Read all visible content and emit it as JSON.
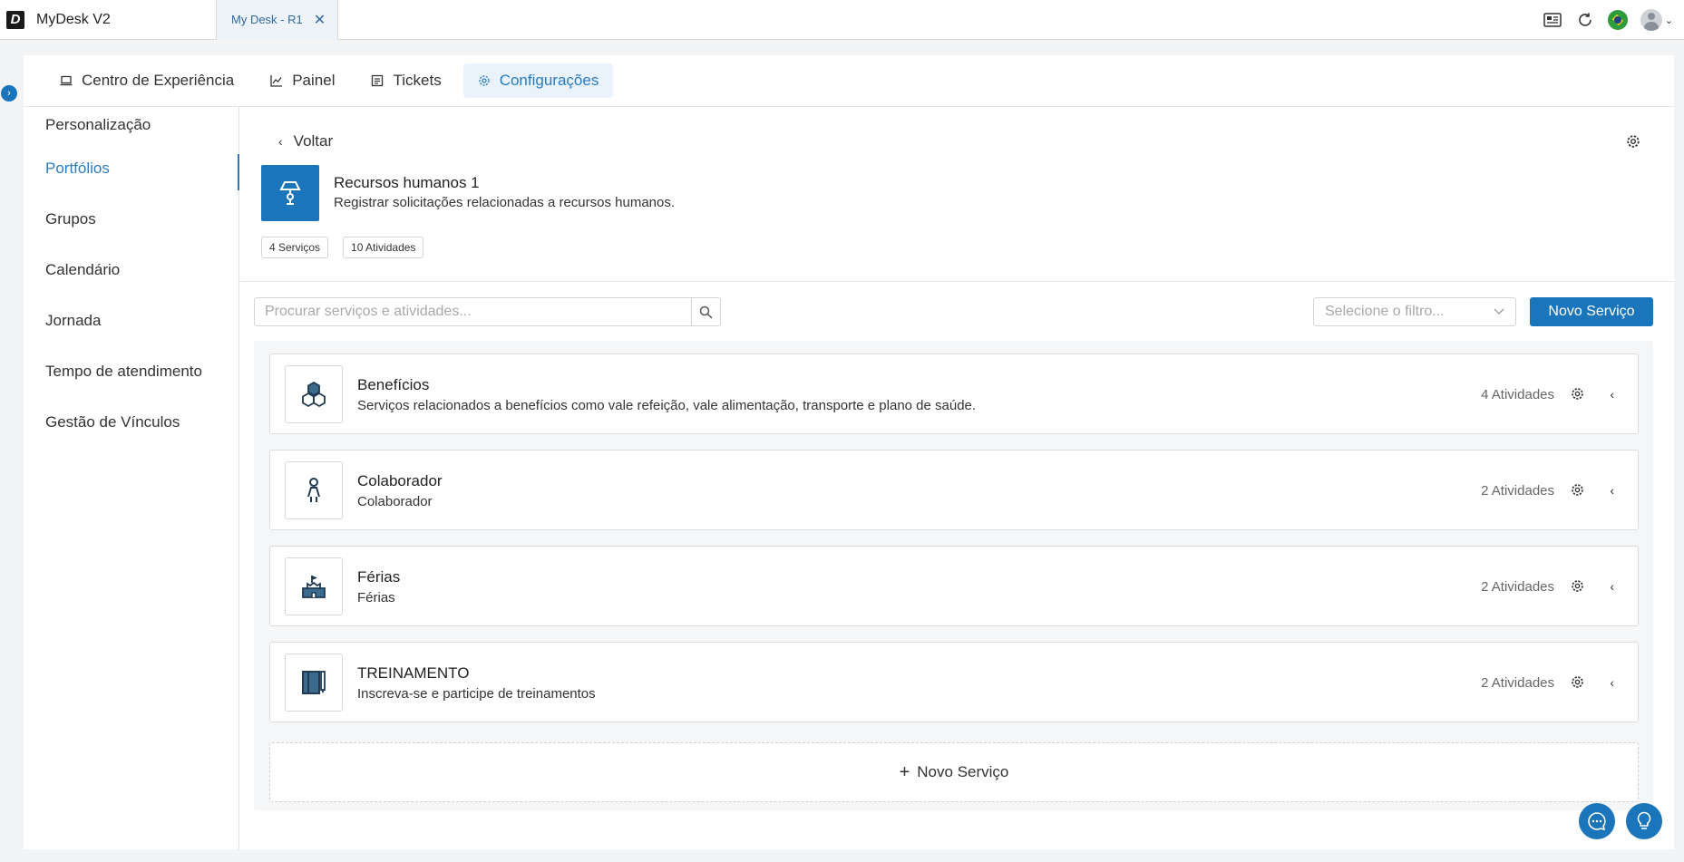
{
  "titlebar": {
    "logo_letter": "D",
    "app_title": "MyDesk V2",
    "tab_label": "My Desk - R1"
  },
  "topnav": [
    {
      "label": "Centro de Experiência",
      "icon": "laptop-icon",
      "active": false
    },
    {
      "label": "Painel",
      "icon": "chart-line-icon",
      "active": false
    },
    {
      "label": "Tickets",
      "icon": "document-list-icon",
      "active": false
    },
    {
      "label": "Configurações",
      "icon": "gear-icon",
      "active": true
    }
  ],
  "sidenav": [
    {
      "label": "Personalização"
    },
    {
      "label": "Portfólios"
    },
    {
      "label": "Grupos"
    },
    {
      "label": "Calendário"
    },
    {
      "label": "Jornada"
    },
    {
      "label": "Tempo de atendimento"
    },
    {
      "label": "Gestão de Vínculos"
    }
  ],
  "portfolio": {
    "back_label": "Voltar",
    "title": "Recursos humanos 1",
    "description": "Registrar solicitações relacionadas a recursos humanos.",
    "chips": [
      "4 Serviços",
      "10 Atividades"
    ]
  },
  "toolbar": {
    "search_placeholder": "Procurar serviços e atividades...",
    "filter_placeholder": "Selecione o filtro...",
    "new_service_label": "Novo Serviço"
  },
  "services": [
    {
      "name": "Benefícios",
      "description": "Serviços relacionados a benefícios como vale refeição, vale alimentação, transporte e plano de saúde.",
      "count": "4 Atividades",
      "icon": "hexagons-icon"
    },
    {
      "name": "Colaborador",
      "description": "Colaborador",
      "count": "2 Atividades",
      "icon": "person-icon"
    },
    {
      "name": "Férias",
      "description": "Férias",
      "count": "2 Atividades",
      "icon": "sandcastle-icon"
    },
    {
      "name": "TREINAMENTO",
      "description": "Inscreva-se e participe de treinamentos",
      "count": "2 Atividades",
      "icon": "notebook-icon"
    }
  ],
  "add_service_label": "Novo Serviço",
  "colors": {
    "accent": "#1a75bb",
    "active_text": "#2a7bc2",
    "icon_dark": "#1f3a52"
  }
}
